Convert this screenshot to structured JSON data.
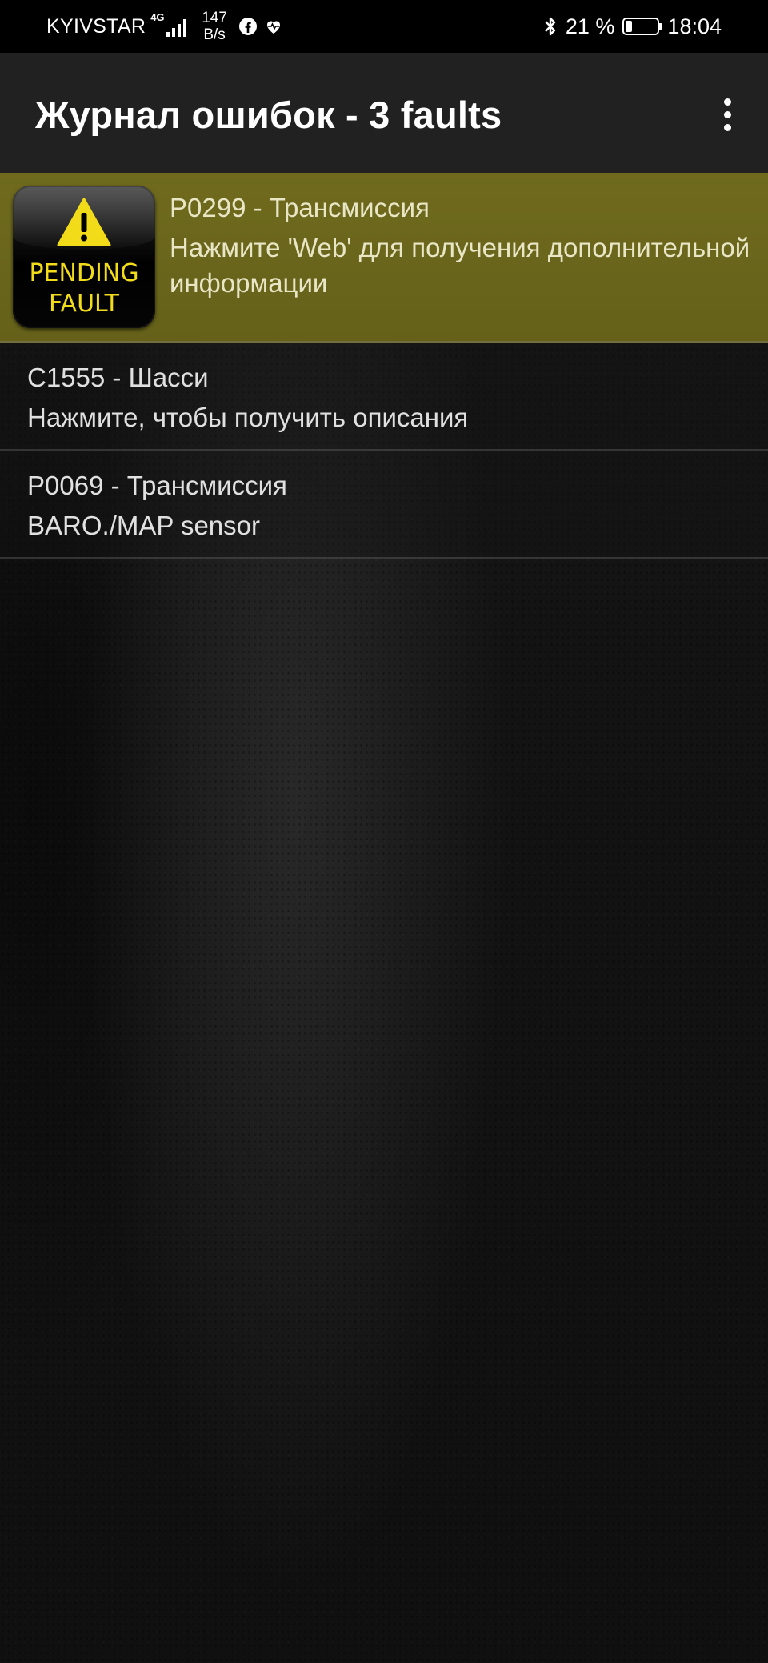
{
  "status_bar": {
    "carrier": "KYIVSTAR",
    "network": "4G",
    "speed_value": "147",
    "speed_unit": "B/s",
    "battery_percent": "21 %",
    "battery_level": 0.21,
    "time": "18:04"
  },
  "app_bar": {
    "title": "Журнал ошибок - 3 faults"
  },
  "faults": [
    {
      "badge_line1": "PENDING",
      "badge_line2": "FAULT",
      "code": "P0299 - Трансмиссия",
      "description": "Нажмите 'Web' для получения дополнительной информации"
    },
    {
      "code": "C1555 - Шасси",
      "description": "Нажмите, чтобы получить описания"
    },
    {
      "code": "P0069 - Трансмиссия",
      "description": "BARO./MAP sensor"
    }
  ],
  "colors": {
    "pending_row": "#6f6a1d",
    "app_bar": "#212121",
    "badge_text": "#f2dc1a"
  }
}
